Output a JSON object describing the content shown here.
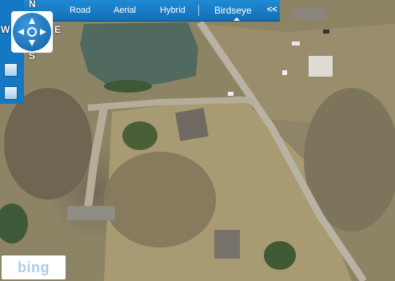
{
  "toolbar": {
    "road": "Road",
    "aerial": "Aerial",
    "hybrid": "Hybrid",
    "birdseye": "Birdseye",
    "collapse": "<<"
  },
  "compass": {
    "north": "N",
    "south": "S",
    "west": "W",
    "east": "E"
  },
  "logo": "bing",
  "colors": {
    "toolbar": "#1677c2",
    "water": "#506a5f",
    "ground": "#8d8466"
  },
  "icons": [
    "compass-icon",
    "birdseye-view-icon",
    "aerial-view-icon"
  ]
}
